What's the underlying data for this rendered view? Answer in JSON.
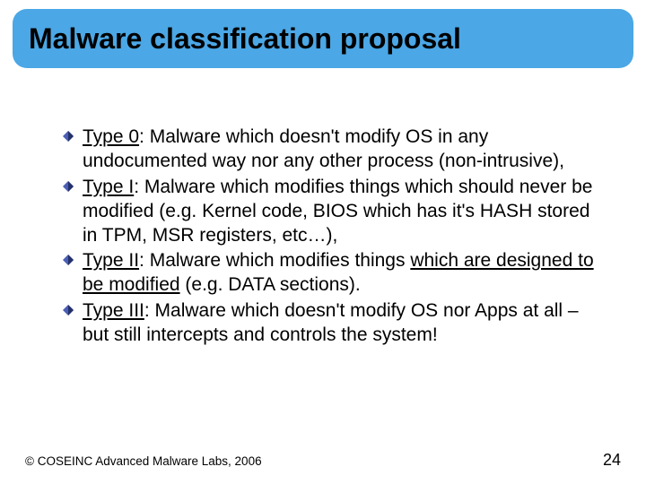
{
  "title": "Malware classification proposal",
  "items": [
    {
      "label": "Type 0",
      "body": ": Malware which doesn't modify OS in any undocumented way nor any other process (non-intrusive),"
    },
    {
      "label": "Type I",
      "body": ": Malware which modifies things which should never be modified (e.g. Kernel code, BIOS which has it's HASH stored in TPM, MSR registers, etc…),"
    },
    {
      "label": "Type II",
      "body_pre": ": Malware which modifies things ",
      "body_u": "which are designed to be modified",
      "body_post": " (e.g. DATA sections)."
    },
    {
      "label": "Type III",
      "body": ": Malware which doesn't modify OS nor Apps at all – but still intercepts and controls the system!"
    }
  ],
  "footer": {
    "copyright": "© COSEINC Advanced Malware Labs, 2006",
    "page": "24"
  },
  "colors": {
    "accent": "#4ba7e5",
    "bullet_fill": "#4a5fb5",
    "bullet_dark": "#233069"
  }
}
